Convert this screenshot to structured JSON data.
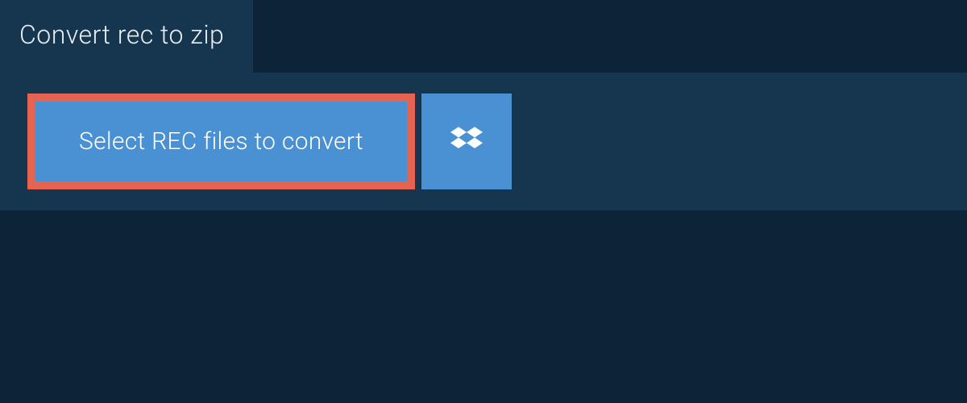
{
  "header": {
    "title": "Convert rec to zip"
  },
  "actions": {
    "select_files_label": "Select REC files to convert",
    "dropbox_icon": "dropbox-icon"
  },
  "colors": {
    "background": "#0d2438",
    "panel": "#16364f",
    "button_primary": "#4a91d4",
    "button_highlight_border": "#e66352",
    "text_light": "#e8eef2",
    "text_white": "#ffffff"
  }
}
